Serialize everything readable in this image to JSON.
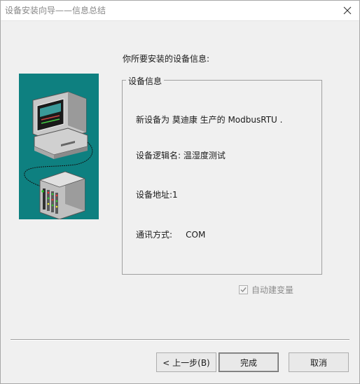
{
  "window": {
    "title": "设备安装向导——信息总结"
  },
  "intro": "你所要安装的设备信息:",
  "group": {
    "title": "设备信息",
    "line_device": "新设备为 莫迪康 生产的 ModbusRTU .",
    "line_logical_name": "设备逻辑名: 温湿度测试",
    "line_address": "设备地址:1",
    "line_comm": "通讯方式:     COM"
  },
  "checkbox": {
    "label": "自动建变量",
    "checked": true,
    "enabled": false
  },
  "buttons": {
    "back": "< 上一步(B)",
    "finish": "完成",
    "cancel": "取消"
  },
  "colors": {
    "illustration_bg": "#0e8080",
    "window_bg": "#f0f0f0"
  }
}
